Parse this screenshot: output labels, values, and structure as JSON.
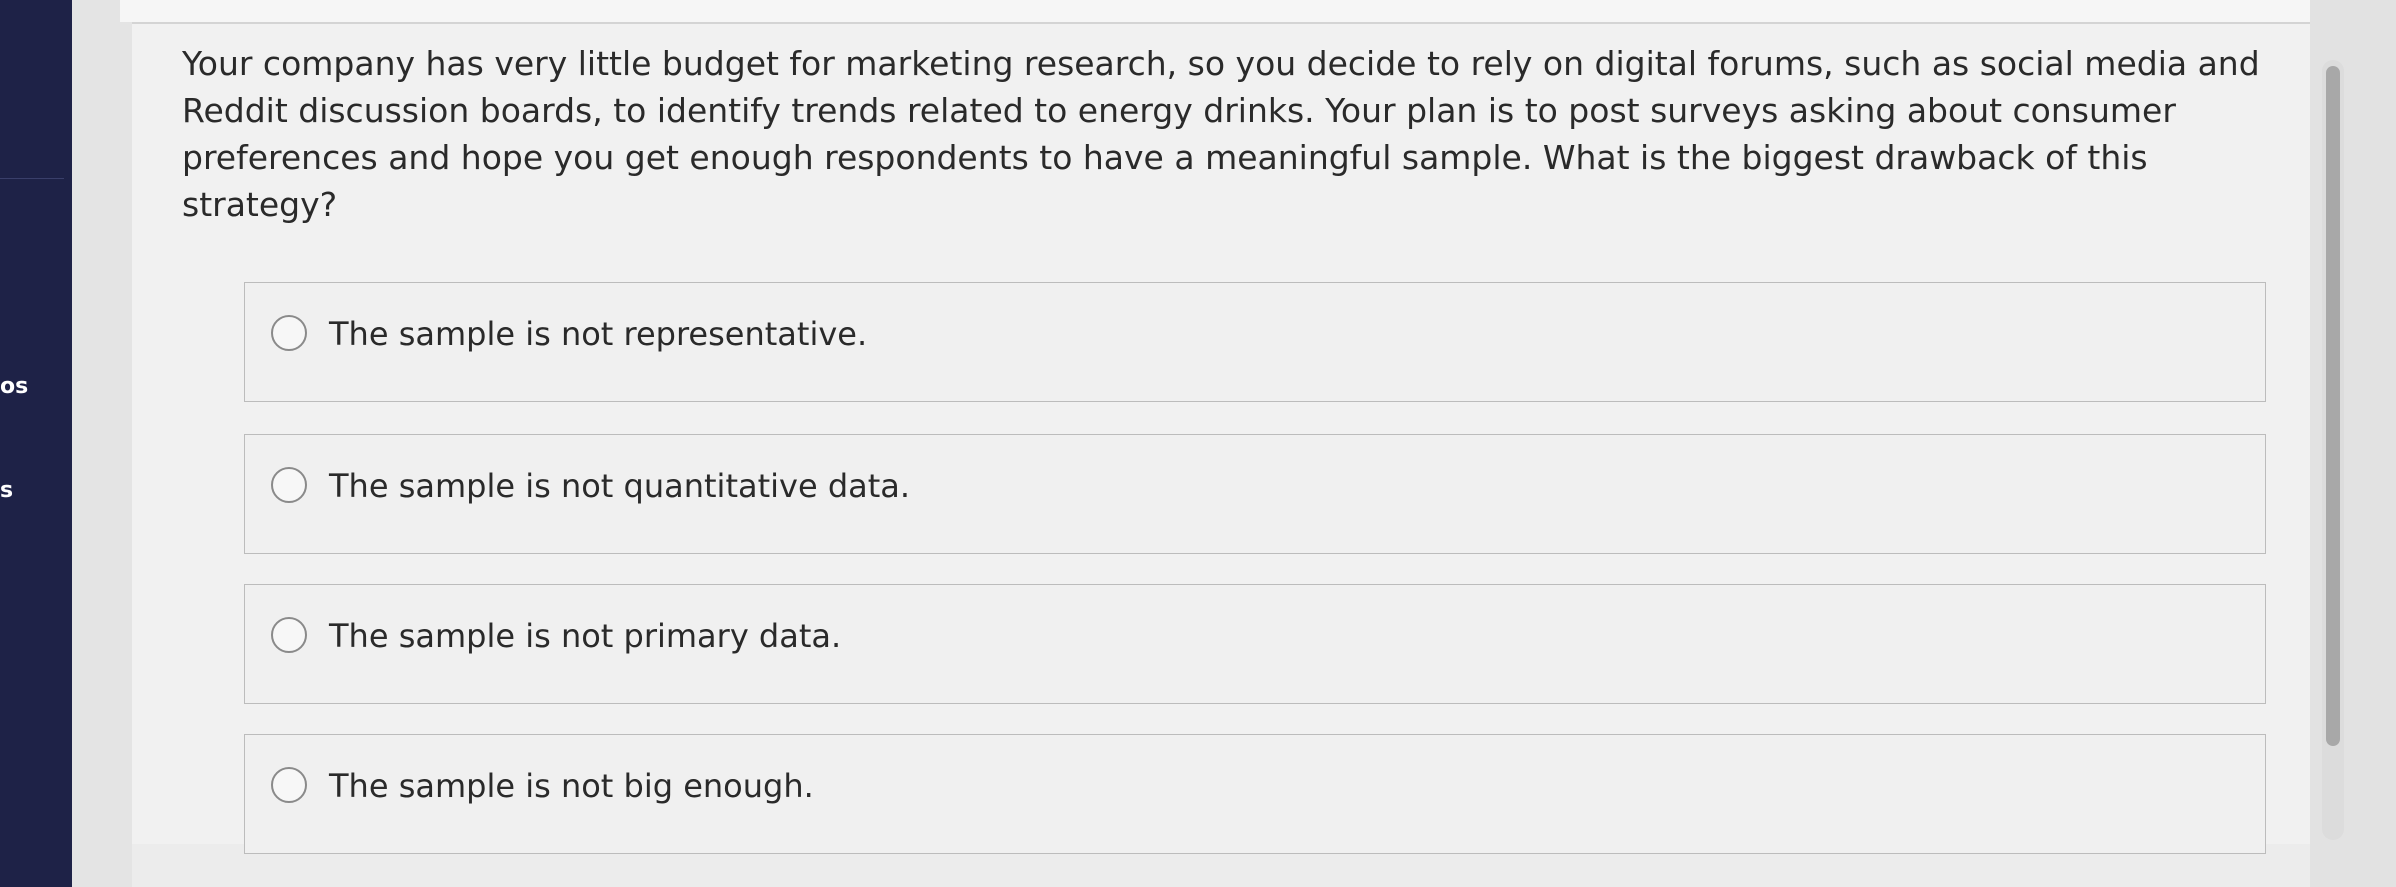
{
  "sidebar": {
    "fragments": [
      "os",
      "s"
    ]
  },
  "question": {
    "text": "Your company has very little budget for marketing research, so you decide to rely on digital forums, such as social media and Reddit discussion boards, to identify trends related to energy drinks. Your plan is to post surveys asking about consumer preferences and hope you get enough respondents to have a meaningful sample. What is the biggest drawback of this strategy?"
  },
  "options": [
    {
      "label": "The sample is not representative."
    },
    {
      "label": "The sample is not quantitative data."
    },
    {
      "label": "The sample is not primary data."
    },
    {
      "label": "The sample is not big enough."
    }
  ],
  "colors": {
    "sidebar": "#1e2247",
    "card": "#f1f1f1",
    "text": "#2a2a2a",
    "option_border": "#bcbcbc"
  },
  "icons": {
    "radio": "radio-unchecked-icon"
  }
}
